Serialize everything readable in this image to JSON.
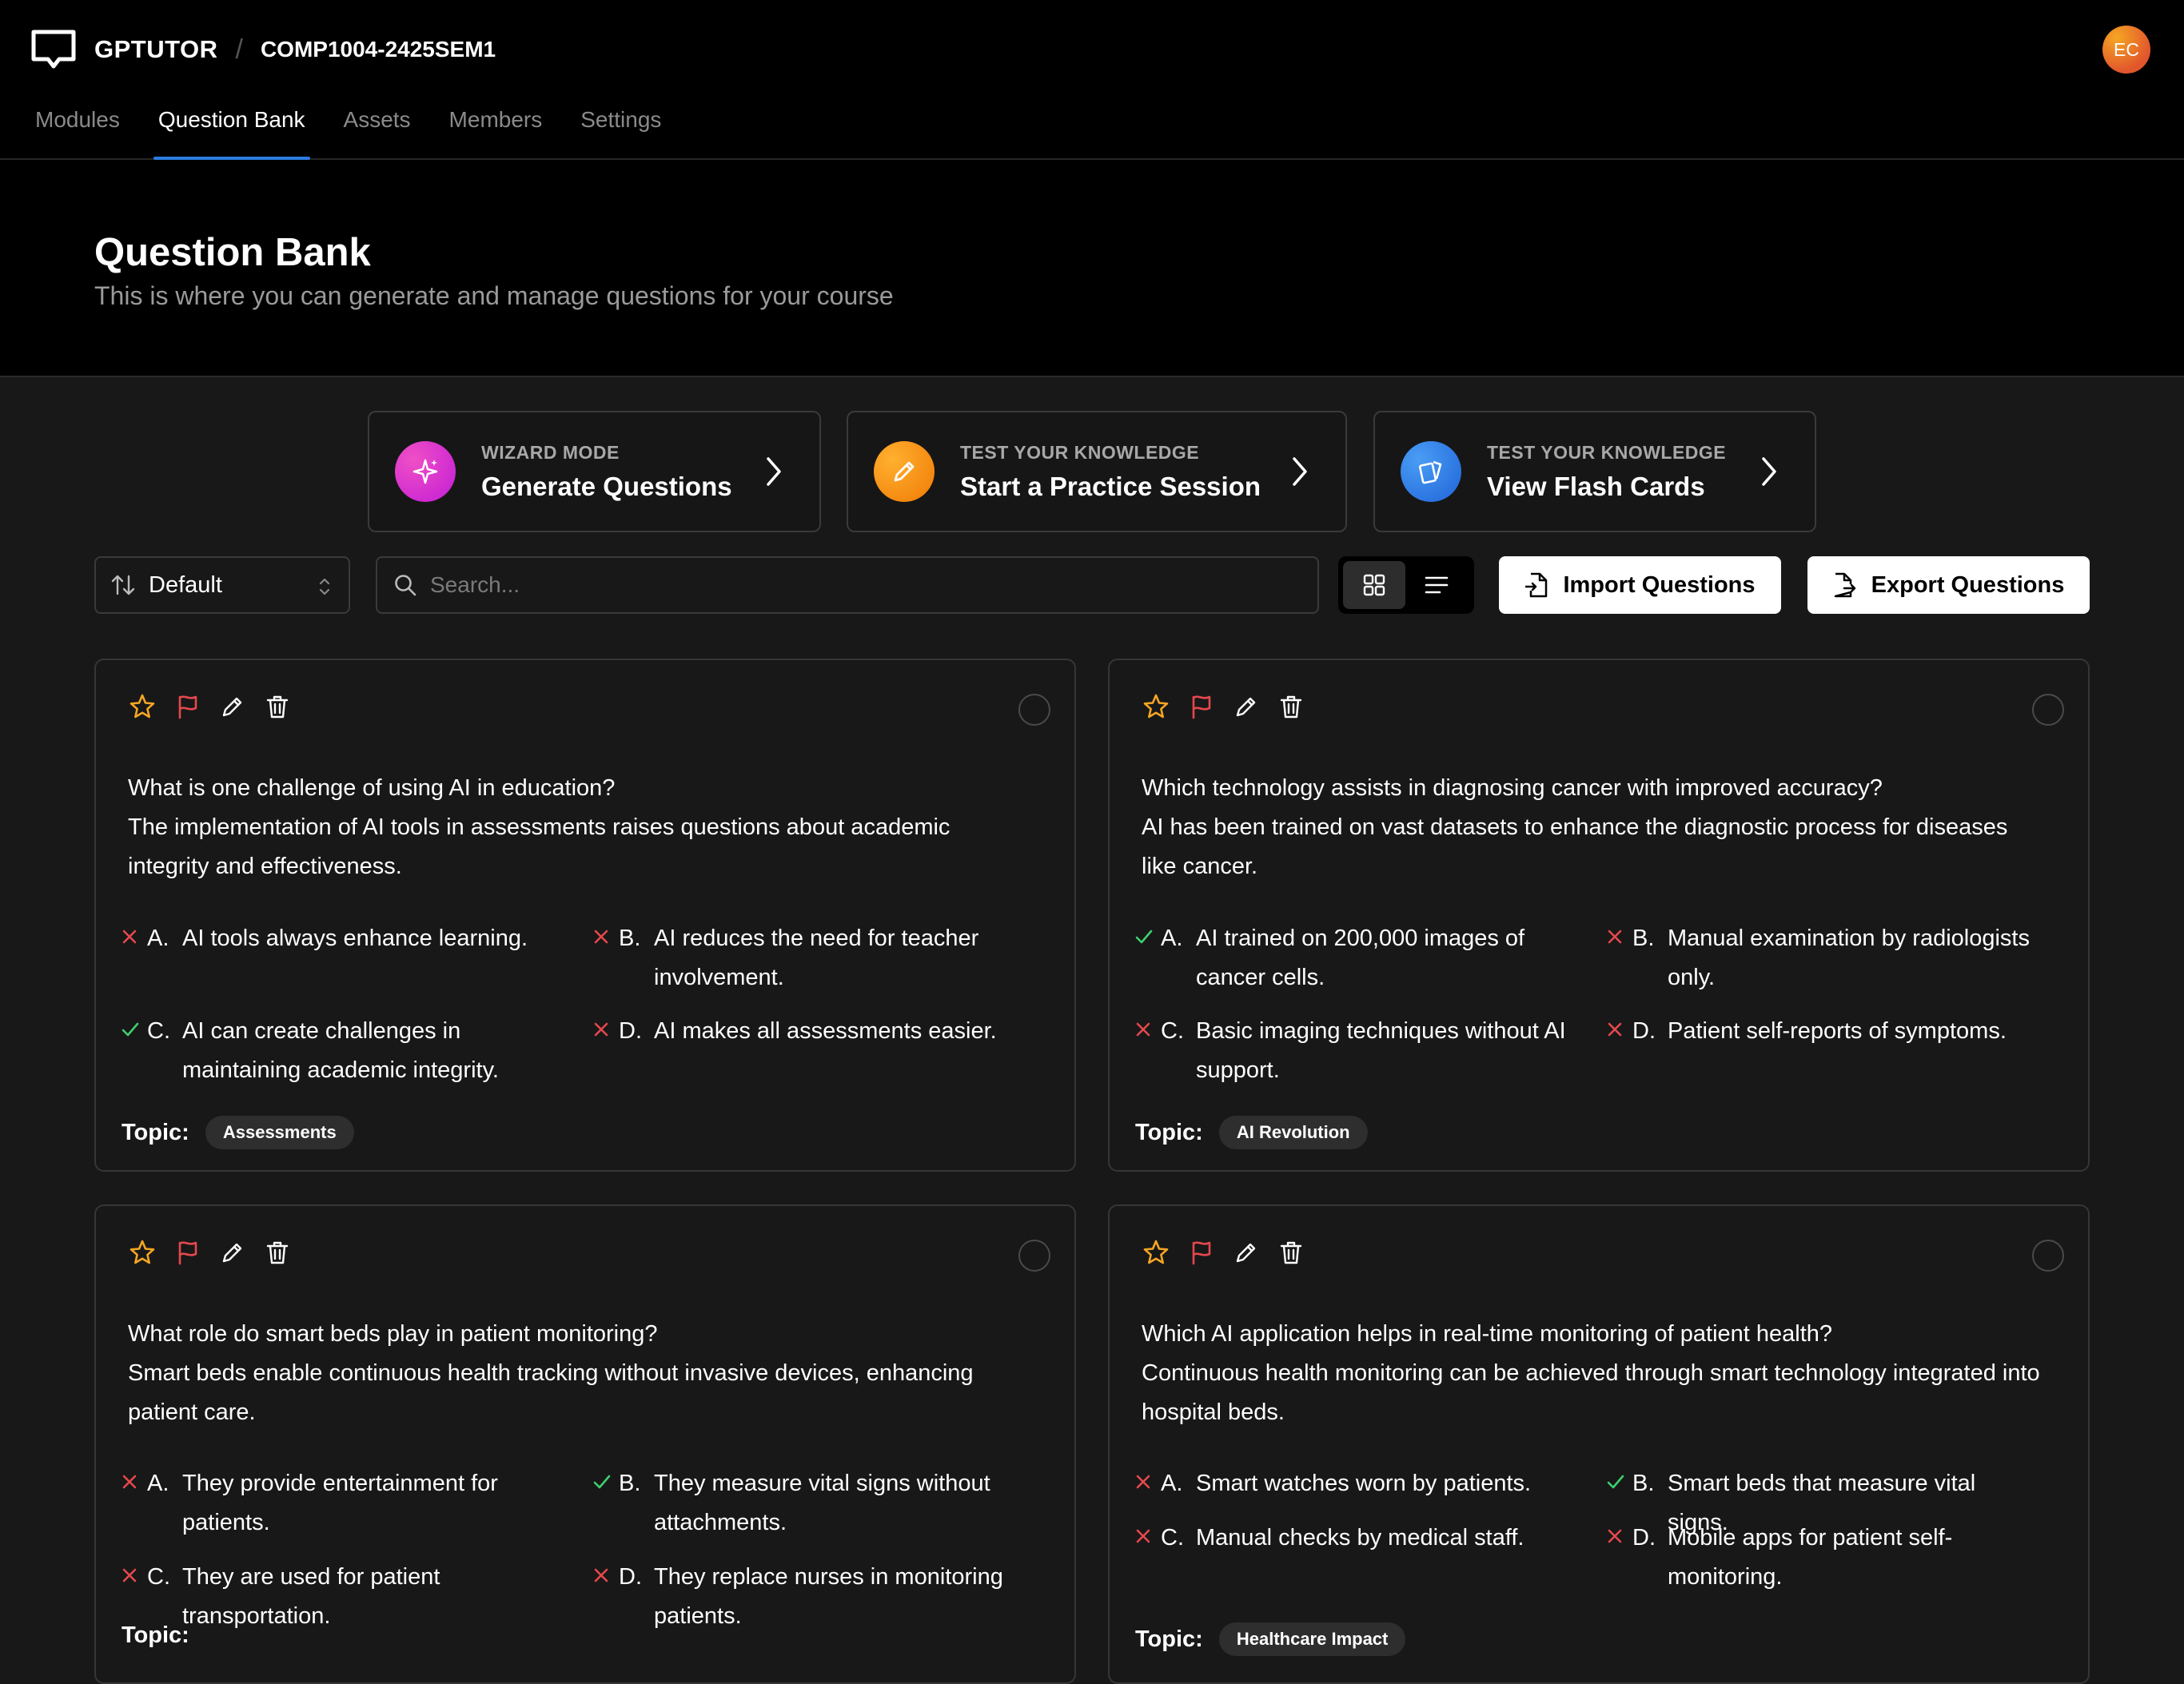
{
  "app": {
    "brand": "GPTUTOR",
    "course": "COMP1004-2425SEM1",
    "avatar_initials": "EC"
  },
  "nav": {
    "tabs": [
      {
        "label": "Modules"
      },
      {
        "label": "Question Bank"
      },
      {
        "label": "Assets"
      },
      {
        "label": "Members"
      },
      {
        "label": "Settings"
      }
    ],
    "active": "Question Bank"
  },
  "page": {
    "title": "Question Bank",
    "subtitle": "This is where you can generate and manage questions for your course"
  },
  "actions": [
    {
      "kicker": "WIZARD MODE",
      "label": "Generate Questions",
      "icon": "sparkles-icon",
      "color": "#e0259f"
    },
    {
      "kicker": "TEST YOUR KNOWLEDGE",
      "label": "Start a Practice Session",
      "icon": "pencil-icon",
      "color": "#f28a0c"
    },
    {
      "kicker": "TEST YOUR KNOWLEDGE",
      "label": "View Flash Cards",
      "icon": "cards-icon",
      "color": "#2f7fe0"
    }
  ],
  "toolbar": {
    "sort_label": "Default",
    "search_placeholder": "Search...",
    "view_mode": "grid",
    "import_label": "Import Questions",
    "export_label": "Export Questions"
  },
  "questions": [
    {
      "question": "What is one challenge of using AI in education?",
      "explanation": "The implementation of AI tools in assessments raises questions about academic integrity and effectiveness.",
      "options": [
        {
          "letter": "A.",
          "text": "AI tools always enhance learning.",
          "correct": false
        },
        {
          "letter": "B.",
          "text": "AI reduces the need for teacher involvement.",
          "correct": false
        },
        {
          "letter": "C.",
          "text": "AI can create challenges in maintaining academic integrity.",
          "correct": true
        },
        {
          "letter": "D.",
          "text": "AI makes all assessments easier.",
          "correct": false
        }
      ],
      "topic_label": "Topic:",
      "topic": "Assessments"
    },
    {
      "question": "Which technology assists in diagnosing cancer with improved accuracy?",
      "explanation": "AI has been trained on vast datasets to enhance the diagnostic process for diseases like cancer.",
      "options": [
        {
          "letter": "A.",
          "text": "AI trained on 200,000 images of cancer cells.",
          "correct": true
        },
        {
          "letter": "B.",
          "text": "Manual examination by radiologists only.",
          "correct": false
        },
        {
          "letter": "C.",
          "text": "Basic imaging techniques without AI support.",
          "correct": false
        },
        {
          "letter": "D.",
          "text": "Patient self-reports of symptoms.",
          "correct": false
        }
      ],
      "topic_label": "Topic:",
      "topic": "AI Revolution"
    },
    {
      "question": "What role do smart beds play in patient monitoring?",
      "explanation": "Smart beds enable continuous health tracking without invasive devices, enhancing patient care.",
      "options": [
        {
          "letter": "A.",
          "text": "They provide entertainment for patients.",
          "correct": false
        },
        {
          "letter": "B.",
          "text": "They measure vital signs without attachments.",
          "correct": true
        },
        {
          "letter": "C.",
          "text": "They are used for patient transportation.",
          "correct": false
        },
        {
          "letter": "D.",
          "text": "They replace nurses in monitoring patients.",
          "correct": false
        }
      ],
      "topic_label": "Topic:",
      "topic": ""
    },
    {
      "question": "Which AI application helps in real-time monitoring of patient health?",
      "explanation": "Continuous health monitoring can be achieved through smart technology integrated into hospital beds.",
      "options": [
        {
          "letter": "A.",
          "text": "Smart watches worn by patients.",
          "correct": false
        },
        {
          "letter": "B.",
          "text": "Smart beds that measure vital signs.",
          "correct": true
        },
        {
          "letter": "C.",
          "text": "Manual checks by medical staff.",
          "correct": false
        },
        {
          "letter": "D.",
          "text": "Mobile apps for patient self-monitoring.",
          "correct": false
        }
      ],
      "topic_label": "Topic:",
      "topic": "Healthcare Impact"
    }
  ],
  "colors": {
    "correct": "#3ecf6e",
    "incorrect": "#e5484d",
    "star": "#f5a524",
    "flag": "#e5484d",
    "accent": "#2b7de0"
  }
}
